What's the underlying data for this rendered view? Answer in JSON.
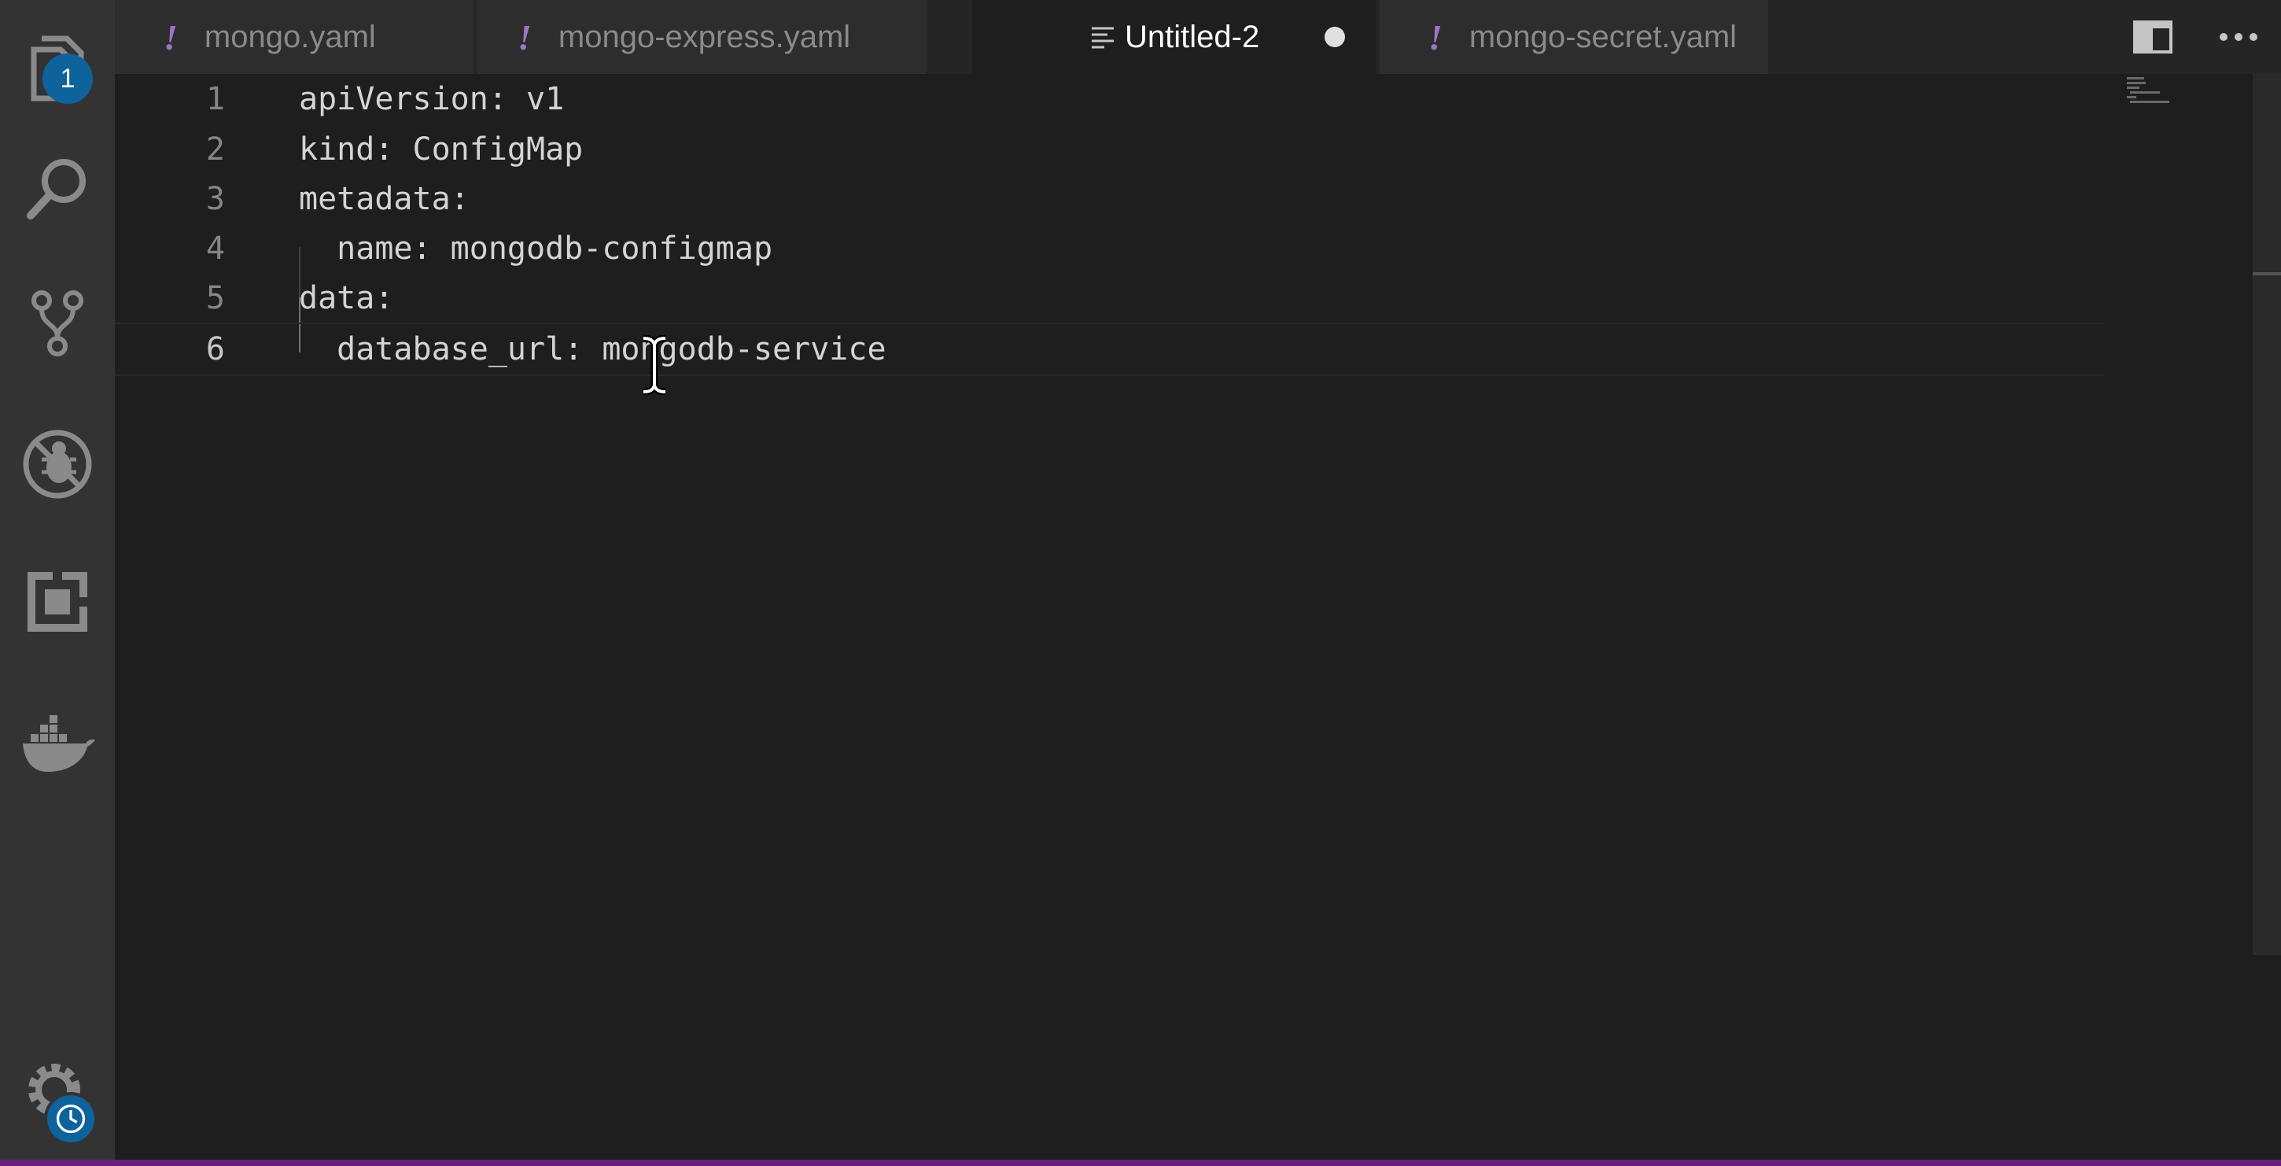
{
  "activity_bar": {
    "items": [
      {
        "icon": "files-icon",
        "badge": "1"
      },
      {
        "icon": "search-icon"
      },
      {
        "icon": "source-control-icon"
      },
      {
        "icon": "no-debug-icon"
      },
      {
        "icon": "extensions-icon"
      },
      {
        "icon": "docker-icon"
      }
    ],
    "manage": {
      "icon": "gear-icon",
      "badge_icon": "clock-icon"
    }
  },
  "tabs": [
    {
      "label": "mongo.yaml",
      "icon": "yaml-exclamation-icon",
      "active": false
    },
    {
      "label": "mongo-express.yaml",
      "icon": "yaml-exclamation-icon",
      "active": false
    },
    {
      "label": "Untitled-2",
      "icon": "plaintext-icon",
      "active": true,
      "dirty": true
    },
    {
      "label": "mongo-secret.yaml",
      "icon": "yaml-exclamation-icon",
      "active": false
    }
  ],
  "tab_marker": "!",
  "tab_actions": {
    "split": "split-editor-icon",
    "more": "more-actions-icon"
  },
  "editor": {
    "lines": [
      {
        "number": "1",
        "text": "apiVersion: v1"
      },
      {
        "number": "2",
        "text": "kind: ConfigMap"
      },
      {
        "number": "3",
        "text": "metadata:"
      },
      {
        "number": "4",
        "text": "  name: mongodb-configmap"
      },
      {
        "number": "5",
        "text": "data:"
      },
      {
        "number": "6",
        "text": "  database_url: mongodb-service"
      }
    ],
    "current_line": "6"
  },
  "colors": {
    "activity_bar": "#333333",
    "editor_bg": "#1e1e1e",
    "badge": "#0e639c",
    "yaml_icon": "#a074c4",
    "status_accent": "#68217a"
  }
}
